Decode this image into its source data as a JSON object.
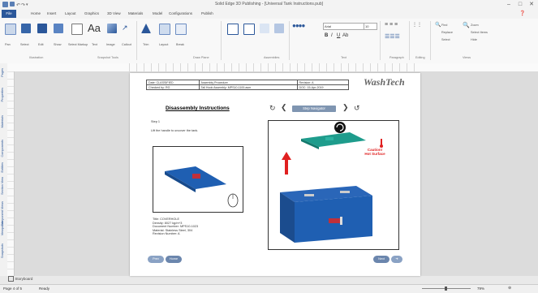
{
  "window": {
    "title": "Solid Edge 3D Publishing - [Universal Tank Instructions.pub]",
    "minimize": "–",
    "maximize": "□",
    "close": "✕"
  },
  "tabs": [
    "File",
    "Home",
    "Insert",
    "Layout",
    "Graphics",
    "3D View",
    "Materials",
    "Model",
    "Configurations",
    "Publish"
  ],
  "ribbon": {
    "groups": [
      "Illustration",
      "Snapshot Tools",
      "Draw Plane",
      "Assemblies",
      "Text",
      "Paragraph",
      "Editing",
      "Views"
    ],
    "buttons": [
      "Pan",
      "Select",
      "Edit",
      "Show",
      "Select Markup",
      "Text",
      "Image",
      "Callout",
      "Trim",
      "Layout",
      "Break"
    ],
    "font_name": "Arial",
    "font_size": "10",
    "font_buttons": [
      "B",
      "I",
      "U",
      "Ab"
    ],
    "find_label": "Find",
    "replace_label": "Replace",
    "select_label": "Select",
    "zoom_label": "Zoom",
    "select_items_label": "Select Items",
    "hide_label": "Hide"
  },
  "left_panel": [
    "Pages",
    "Properties",
    "Materials",
    "Components",
    "Entities",
    "Section View",
    "Component Views",
    "Viewpoints",
    "Snapshots"
  ],
  "document": {
    "meta": {
      "row1": [
        "Date: CLASSIFIED",
        "Assembly Procedure",
        "Revision: A"
      ],
      "row2": [
        "Checked by: RG",
        "Tall Hook Assembly: MPS10-1100.asm",
        "DOC: 15-Apr-2019"
      ]
    },
    "logo": "WashTech",
    "heading": "Disassembly Instructions",
    "step_nav": "Step Navigator",
    "step_title": "Step 1",
    "step_text": "Lift the handle to uncover the tank.",
    "info": [
      "Title: COVERHOLE",
      "Density: 8027 kg/m^3",
      "Document Number: MPS10-1023",
      "Material: Stainless Steel, 304",
      "Revision Number: A"
    ],
    "caution": "Caution!\nHot Surface",
    "prev_label": "Prev",
    "next_label": "Next",
    "home_label": "Home"
  },
  "storyboard_label": "Storyboard",
  "status": {
    "page": "Page 4 of 5",
    "state": "Ready",
    "zoom": "79%"
  },
  "colors": {
    "accent": "#2b579a",
    "model_blue": "#1f5fb2",
    "lid_teal": "#1e9c8c",
    "caution_red": "#e02020"
  }
}
